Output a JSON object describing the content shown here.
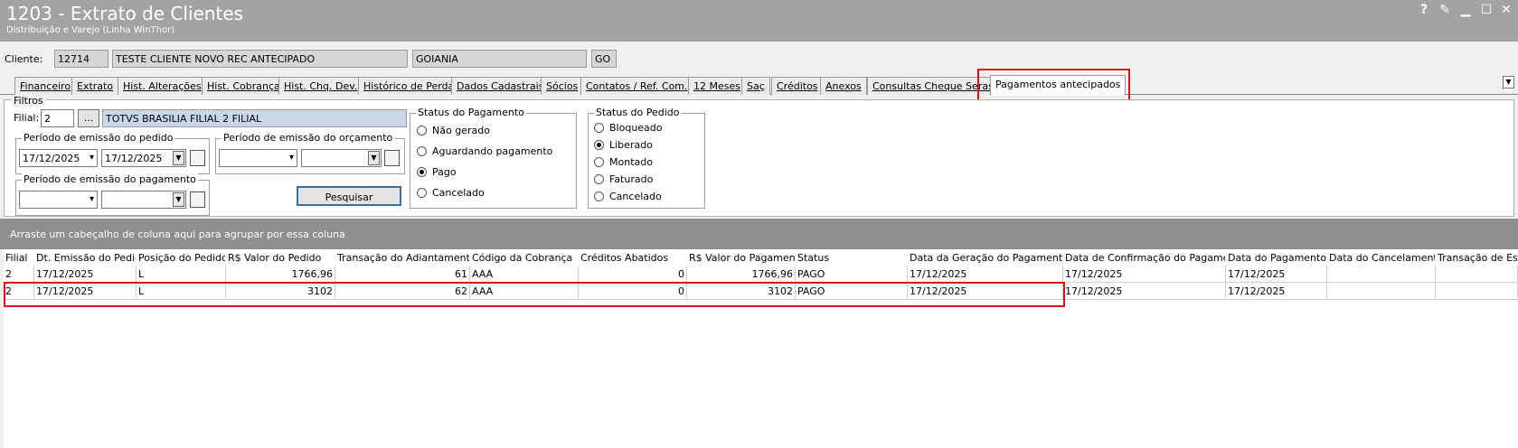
{
  "window": {
    "title": "1203 - Extrato de Clientes",
    "subtitle": "Distribuição e Varejo (Linha WinThor)",
    "controls": [
      "?",
      "✎",
      "▁",
      "☐",
      "✕"
    ]
  },
  "client": {
    "label": "Cliente:",
    "code": "12714",
    "name": "TESTE CLIENTE NOVO REC ANTECIPADO",
    "city": "GOIANIA",
    "state": "GO"
  },
  "tabs": [
    "Financeiro",
    "Extrato",
    "Hist. Alterações",
    "Hist. Cobrança",
    "Hist. Chq. Dev.",
    "Histórico de Perda",
    "Dados Cadastrais",
    "Sócios",
    "Contatos / Ref. Com.",
    "12 Meses",
    "Saç",
    "Créditos",
    "Anexos",
    "Consultas Cheque Serasa",
    "Pagamentos antecipados"
  ],
  "filters": {
    "title": "Filtros",
    "filial_label": "Filial:",
    "filial_value": "2",
    "filial_btn": "...",
    "filial_name": "TOTVS BRASILIA FILIAL 2 FILIAL",
    "periodo_pedido": {
      "title": "Período de emissão do pedido",
      "from": "17/12/2025",
      "to": "17/12/2025"
    },
    "periodo_orcamento": {
      "title": "Período de emissão do orçamento",
      "from": "",
      "to": ""
    },
    "periodo_pagamento": {
      "title": "Período de emissão do pagamento",
      "from": "",
      "to": ""
    },
    "search_button": "Pesquisar",
    "status_pagamento": {
      "title": "Status do Pagamento",
      "options": [
        "Não gerado",
        "Aguardando pagamento",
        "Pago",
        "Cancelado"
      ],
      "selected": "Pago"
    },
    "status_pedido": {
      "title": "Status do Pedido",
      "options": [
        "Bloqueado",
        "Liberado",
        "Montado",
        "Faturado",
        "Cancelado"
      ],
      "selected": "Liberado"
    }
  },
  "grid": {
    "group_hint": "Arraste um cabeçalho de coluna aqui para agrupar por essa coluna",
    "columns": [
      "Filial",
      "Dt. Emissão do Pedido",
      "Posição do Pedido",
      "R$ Valor do Pedido",
      "Transação do Adiantamento",
      "Código da Cobrança",
      "Créditos Abatidos",
      "R$ Valor do Pagamento",
      "Status",
      "Data da Geração do Pagamento",
      "Data de Confirmação do Pagamento",
      "Data do Pagamento",
      "Data do Cancelamento",
      "Transação de Esto"
    ],
    "rows": [
      [
        "2",
        "17/12/2025",
        "L",
        "1766,96",
        "61",
        "AAA",
        "0",
        "1766,96",
        "PAGO",
        "17/12/2025",
        "17/12/2025",
        "17/12/2025",
        "",
        ""
      ],
      [
        "2",
        "17/12/2025",
        "L",
        "3102",
        "62",
        "AAA",
        "0",
        "3102",
        "PAGO",
        "17/12/2025",
        "17/12/2025",
        "17/12/2025",
        "",
        ""
      ]
    ]
  },
  "colors": {
    "titlebar": "#a3a3a3",
    "highlight": "#e01010",
    "groupbar": "#8f8f8f"
  }
}
